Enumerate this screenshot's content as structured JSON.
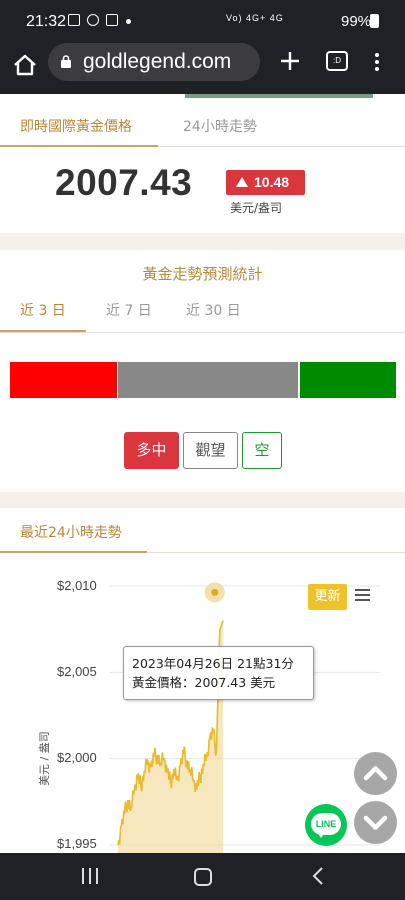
{
  "status_bar": {
    "time": "21:32",
    "network_text": "Vo) 4G+  4G",
    "battery": "99%"
  },
  "browser": {
    "url": "goldlegend.com",
    "tab_count": ":D"
  },
  "price_card": {
    "tabs": [
      {
        "label": "即時國際黃金價格",
        "active": true
      },
      {
        "label": "24小時走勢",
        "active": false
      }
    ],
    "price": "2007.43",
    "change": "10.48",
    "change_direction": "up",
    "unit": "美元/盎司",
    "colors": {
      "accent": "#b9873a",
      "up": "#d9363e"
    }
  },
  "forecast_card": {
    "title": "黃金走勢預測統計",
    "tabs": [
      {
        "label": "近 3 日",
        "active": true
      },
      {
        "label": "近 7 日",
        "active": false
      },
      {
        "label": "近 30 日",
        "active": false
      }
    ],
    "distribution": [
      {
        "name": "多中",
        "fraction": 0.28,
        "color": "#ff0000"
      },
      {
        "name": "觀望",
        "fraction": 0.47,
        "color": "#888888"
      },
      {
        "name": "空",
        "fraction": 0.25,
        "color": "#008a00"
      }
    ],
    "buttons": [
      {
        "label": "多中",
        "style": "filled-red"
      },
      {
        "label": "觀望",
        "style": "outline-gray"
      },
      {
        "label": "空",
        "style": "outline-green"
      }
    ]
  },
  "chart_card": {
    "tab_label": "最近24小時走勢",
    "update_label": "更新",
    "tooltip": {
      "line1": "2023年04月26日 21點31分",
      "line2": "黃金價格：2007.43 美元"
    }
  },
  "chart_data": {
    "type": "area",
    "title": "",
    "xlabel": "",
    "ylabel": "美元 / 盎司",
    "y_tick_labels": [
      "$2,010",
      "$2,005",
      "$2,000",
      "$1,995"
    ],
    "ylim": [
      1995,
      2010
    ],
    "grid": true,
    "series": [
      {
        "values": [
          1995.0,
          1996.1,
          1996.8,
          1997.6,
          1997.1,
          1998.2,
          1998.9,
          1998.4,
          1999.3,
          1999.9,
          1999.5,
          2000.1,
          2000.2,
          1999.7,
          2000.0,
          1999.2,
          1998.6,
          1999.4,
          1998.8,
          1999.6,
          2000.3,
          1999.9,
          1999.3,
          1998.7,
          1998.2,
          1998.9,
          1999.7,
          2000.1,
          2001.2,
          2001.5,
          2000.4,
          2007.43,
          2008.0
        ]
      }
    ],
    "highlight": {
      "label": "2023年04月26日 21點31分",
      "value": 2007.43
    }
  },
  "navbar": {
    "buttons": [
      "recent-apps",
      "home",
      "back"
    ]
  }
}
